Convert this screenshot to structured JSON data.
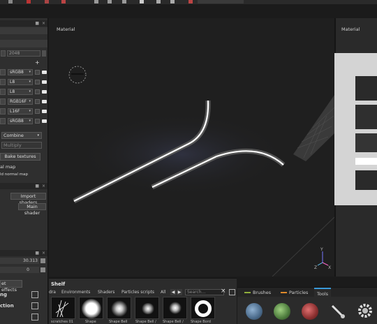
{
  "viewport": {
    "label": "Material"
  },
  "right_viewport": {
    "label": "Material"
  },
  "left_panel": {
    "resolution_value": "2048",
    "texture_formats": [
      "sRGB8",
      "L8",
      "L8",
      "RGB16F",
      "L16F",
      "sRGB8"
    ],
    "combine_label": "Combine",
    "multiply_label": "Multiply",
    "bake_textures_label": "Bake textures",
    "normal_map_label": "al map",
    "normal_map2_label": "ld normal map",
    "import_shaders_label": "Import shaders",
    "main_shader_label": "Main shader",
    "value_1": "30.313",
    "value_2": "0",
    "effects_label": "et effects",
    "section_1_label": "ng",
    "section_2_label": "ction"
  },
  "shelf": {
    "title": "Shelf",
    "tabs": [
      "dra",
      "Environments",
      "Shaders",
      "Particles scripts",
      "All"
    ],
    "search_placeholder": "Search...",
    "items": [
      {
        "label": "scratches 01",
        "kind": "scratch"
      },
      {
        "label": "Shape",
        "kind": "soft-large"
      },
      {
        "label": "Shape Bell",
        "kind": "soft-mid"
      },
      {
        "label": "Shape Bell /",
        "kind": "soft-small"
      },
      {
        "label": "Shape Bell /",
        "kind": "soft-tiny"
      },
      {
        "label": "Shape Bord",
        "kind": "ring"
      }
    ]
  },
  "tools_panel": {
    "tabs": [
      {
        "label": "Brushes",
        "color": "#8fae3c"
      },
      {
        "label": "Particles",
        "color": "#e08a2a"
      },
      {
        "label": "Tools",
        "color": "#3a9ad9"
      }
    ],
    "balls": [
      {
        "name": "blue-particle-ball",
        "color": "#4a6a8a"
      },
      {
        "name": "green-particle-ball",
        "color": "#4c7a3c"
      },
      {
        "name": "red-particle-ball",
        "color": "#8a2f2f"
      }
    ]
  },
  "axis_gizmo": {
    "x": "X",
    "y": "Y",
    "z": "Z"
  }
}
